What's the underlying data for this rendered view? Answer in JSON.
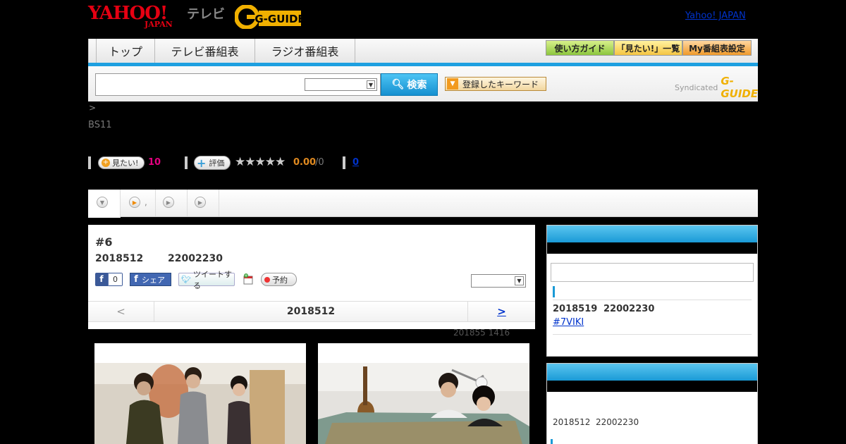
{
  "header": {
    "yahoo_logo": "YAHOO!",
    "yahoo_logo_sub": "JAPAN",
    "tv_label": "テレビ",
    "gguide_logo": "G-GUIDE",
    "yj_link": "Yahoo! JAPAN"
  },
  "nav": {
    "tabs": [
      {
        "label": "トップ"
      },
      {
        "label": "テレビ番組表"
      },
      {
        "label": "ラジオ番組表"
      }
    ],
    "sub_buttons": [
      {
        "label": "使い方ガイド"
      },
      {
        "label": "「見たい!」一覧"
      },
      {
        "label": "My番組表設定"
      }
    ]
  },
  "search": {
    "button_label": "検索",
    "keyword_button": "登録したキーワード",
    "syndicated": "Syndicated"
  },
  "breadcrumb": ">",
  "channel": "BS11",
  "stats": {
    "want_label": "見たい!",
    "want_count": "10",
    "rate_label": "評価",
    "stars": "★★★★★",
    "score": "0.00",
    "score_of": "/0",
    "review_count": "0"
  },
  "tabs": [
    {
      "name": "tab-1",
      "label": ""
    },
    {
      "name": "tab-2",
      "label": ","
    },
    {
      "name": "tab-3",
      "label": ""
    },
    {
      "name": "tab-4",
      "label": ""
    }
  ],
  "episode": {
    "title": "#6",
    "date": "2018512",
    "time": "22002230",
    "fb_like": "0",
    "fb_share": "シェア",
    "tweet": "ツイートする",
    "reserve": "予約",
    "pager_prev": "<",
    "pager_current": "2018512",
    "pager_next": ">",
    "updated": "201855  1416"
  },
  "sidebar": {
    "box1": {
      "date": "2018519",
      "time": "22002230",
      "link": "#7VIKI"
    },
    "box2": {
      "date": "2018512",
      "time": "22002230"
    }
  },
  "colors": {
    "accent": "#1a9ad6",
    "want_count": "#e4007f",
    "score": "#e08a20",
    "link": "#0033cc"
  }
}
